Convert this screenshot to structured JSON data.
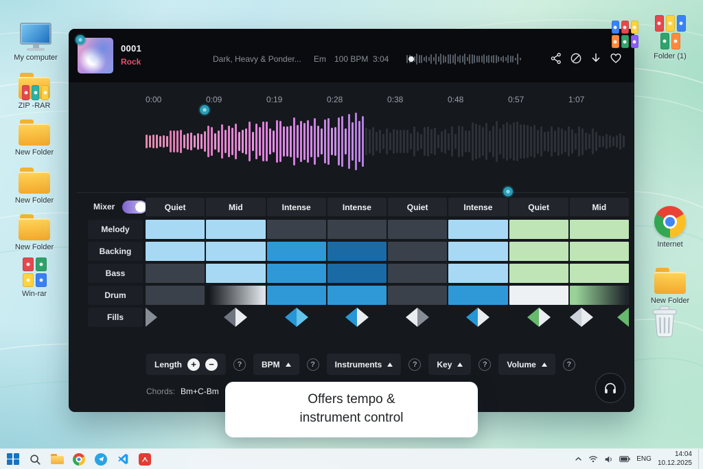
{
  "desktop": {
    "icons": [
      {
        "id": "my-computer",
        "type": "computer",
        "label": "My computer"
      },
      {
        "id": "zip-rar",
        "type": "zip",
        "label": "ZIP -RAR"
      },
      {
        "id": "new-folder-1",
        "type": "folder",
        "label": "New Folder"
      },
      {
        "id": "new-folder-2",
        "type": "folder",
        "label": "New Folder"
      },
      {
        "id": "new-folder-3",
        "type": "folder",
        "label": "New Folder"
      },
      {
        "id": "win-rar",
        "type": "books",
        "label": "Win-rar"
      },
      {
        "id": "folder-1",
        "type": "cluster",
        "label": "Folder (1)"
      },
      {
        "id": "internet",
        "type": "chrome",
        "label": "Internet"
      },
      {
        "id": "new-folder-4",
        "type": "folder",
        "label": "New Folder"
      },
      {
        "id": "recycle-bin",
        "type": "trash",
        "label": ""
      },
      {
        "id": "corner-cluster",
        "type": "cluster2",
        "label": ""
      }
    ]
  },
  "player": {
    "track_number": "0001",
    "genre": "Rock",
    "descriptor": "Dark, Heavy & Ponder...",
    "key": "Em",
    "bpm": "100 BPM",
    "duration": "3:04",
    "timeline": [
      "0:00",
      "0:09",
      "0:19",
      "0:28",
      "0:38",
      "0:48",
      "0:57",
      "1:07"
    ]
  },
  "mixer": {
    "toggle_label": "Mixer",
    "toggle_on": true,
    "columns": [
      "Quiet",
      "Mid",
      "Intense",
      "Intense",
      "Quiet",
      "Intense",
      "Quiet",
      "Mid"
    ],
    "cell_colors": {
      "lb": "#a7d9f4",
      "mb": "#2f99d8",
      "db": "#1a6aa6",
      "dg": "#3a414a",
      "lg": "#bfe5b6",
      "wh": "#eef1f3",
      "gdl": "linear-gradient(90deg,#14171c 5%,#dde3e8 95%)",
      "ggd": "linear-gradient(90deg,#98d298 10%,#1f262b 95%)"
    },
    "rows": [
      {
        "label": "Melody",
        "cells": [
          "lb",
          "lb",
          "dg",
          "dg",
          "dg",
          "lb",
          "lg",
          "lg"
        ]
      },
      {
        "label": "Backing",
        "cells": [
          "lb",
          "lb",
          "mb",
          "db",
          "dg",
          "lb",
          "lg",
          "lg"
        ]
      },
      {
        "label": "Bass",
        "cells": [
          "dg",
          "lb",
          "mb",
          "db",
          "dg",
          "lb",
          "lg",
          "lg"
        ]
      },
      {
        "label": "Drum",
        "cells": [
          "dg",
          "gdl",
          "mb",
          "mb",
          "dg",
          "mb",
          "wh",
          "ggd"
        ]
      },
      {
        "label": "Fills"
      }
    ],
    "fills": [
      {
        "j": "start",
        "groups": [
          [
            {
              "d": "r",
              "c": "#868d95"
            }
          ]
        ]
      },
      {
        "j": "center",
        "groups": [
          [
            {
              "d": "l",
              "c": "#6f7680"
            },
            {
              "d": "r",
              "c": "#e9edf0"
            }
          ]
        ]
      },
      {
        "j": "center",
        "groups": [
          [
            {
              "d": "l",
              "c": "#2796d6"
            },
            {
              "d": "r",
              "c": "#63c3ea"
            }
          ]
        ]
      },
      {
        "j": "center",
        "groups": [
          [
            {
              "d": "l",
              "c": "#2796d6"
            },
            {
              "d": "r",
              "c": "#e9edf0"
            }
          ]
        ]
      },
      {
        "j": "center",
        "groups": [
          [
            {
              "d": "l",
              "c": "#e9edf0"
            },
            {
              "d": "r",
              "c": "#868d95"
            }
          ]
        ]
      },
      {
        "j": "center",
        "groups": [
          [
            {
              "d": "l",
              "c": "#2796d6"
            },
            {
              "d": "r",
              "c": "#e9edf0"
            }
          ]
        ]
      },
      {
        "j": "center",
        "groups": [
          [
            {
              "d": "l",
              "c": "#67b96d"
            },
            {
              "d": "r",
              "c": "#e9edf0"
            }
          ]
        ]
      },
      {
        "j": "between",
        "groups": [
          [
            {
              "d": "l",
              "c": "#ccd3da"
            },
            {
              "d": "r",
              "c": "#e9edf0"
            }
          ],
          [
            {
              "d": "l",
              "c": "#67b96d"
            }
          ]
        ]
      }
    ]
  },
  "controls": {
    "length_label": "Length",
    "plus": "+",
    "minus": "−",
    "bpm_label": "BPM",
    "instruments_label": "Instruments",
    "key_label": "Key",
    "volume_label": "Volume",
    "help_symbol": "?",
    "chords_label": "Chords:",
    "chords_value": "Bm+C-Bm"
  },
  "tooltip": {
    "line1": "Offers tempo &",
    "line2": "instrument control"
  },
  "taskbar": {
    "apps": [
      "start",
      "search",
      "explorer",
      "chrome",
      "telegram",
      "vscode",
      "reader"
    ],
    "tray_lang": "ENG",
    "tray_time": "14:04",
    "tray_date": "10.12.2025"
  }
}
